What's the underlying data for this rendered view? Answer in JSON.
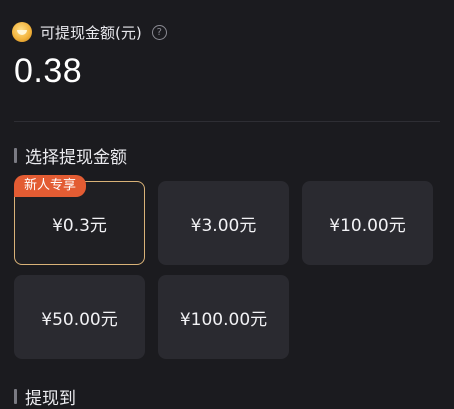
{
  "header": {
    "title": "可提现金额(元)",
    "help_icon": "?",
    "coin_icon": "coin-icon"
  },
  "balance": "0.38",
  "withdraw_section": {
    "title": "选择提现金额",
    "badge": "新人专享",
    "options": [
      {
        "label": "¥0.3元",
        "selected": true
      },
      {
        "label": "¥3.00元",
        "selected": false
      },
      {
        "label": "¥10.00元",
        "selected": false
      },
      {
        "label": "¥50.00元",
        "selected": false
      },
      {
        "label": "¥100.00元",
        "selected": false
      }
    ]
  },
  "destination_section": {
    "title": "提现到"
  },
  "colors": {
    "background": "#1b1b1f",
    "card": "#2a2a30",
    "selected_border": "#d9b278",
    "badge": "#e35c33"
  }
}
